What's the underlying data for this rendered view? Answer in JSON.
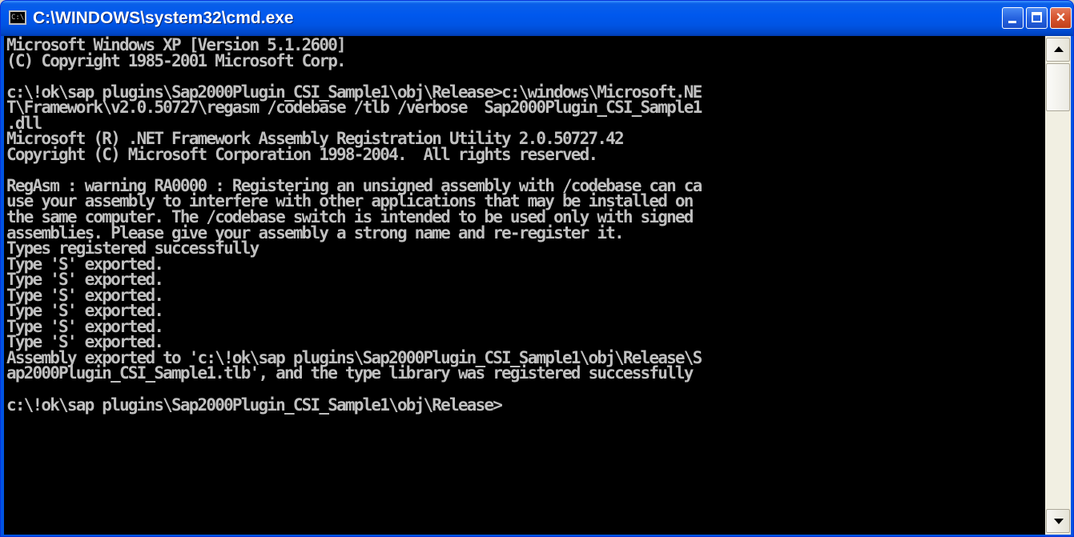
{
  "window": {
    "title": "C:\\WINDOWS\\system32\\cmd.exe",
    "icon_label": "C:\\",
    "controls": {
      "minimize": "minimize",
      "maximize": "maximize",
      "close": "×"
    }
  },
  "console": {
    "text": "Microsoft Windows XP [Version 5.1.2600]\n(C) Copyright 1985-2001 Microsoft Corp.\n\nc:\\!ok\\sap plugins\\Sap2000Plugin_CSI_Sample1\\obj\\Release>c:\\windows\\Microsoft.NE\nT\\Framework\\v2.0.50727\\regasm /codebase /tlb /verbose  Sap2000Plugin_CSI_Sample1\n.dll\nMicrosoft (R) .NET Framework Assembly Registration Utility 2.0.50727.42\nCopyright (C) Microsoft Corporation 1998-2004.  All rights reserved.\n\nRegAsm : warning RA0000 : Registering an unsigned assembly with /codebase can ca\nuse your assembly to interfere with other applications that may be installed on\nthe same computer. The /codebase switch is intended to be used only with signed\nassemblies. Please give your assembly a strong name and re-register it.\nTypes registered successfully\nType 'S' exported.\nType 'S' exported.\nType 'S' exported.\nType 'S' exported.\nType 'S' exported.\nType 'S' exported.\nAssembly exported to 'c:\\!ok\\sap plugins\\Sap2000Plugin_CSI_Sample1\\obj\\Release\\S\nap2000Plugin_CSI_Sample1.tlb', and the type library was registered successfully\n\nc:\\!ok\\sap plugins\\Sap2000Plugin_CSI_Sample1\\obj\\Release>"
  },
  "colors": {
    "titlebar": "#0054e3",
    "console_background": "#000000",
    "console_text": "#c0c0c0",
    "close_button": "#d6542e"
  },
  "icons": [
    "cmd-app-icon",
    "minimize-icon",
    "maximize-icon",
    "close-icon",
    "scroll-up-arrow-icon",
    "scroll-down-arrow-icon"
  ]
}
